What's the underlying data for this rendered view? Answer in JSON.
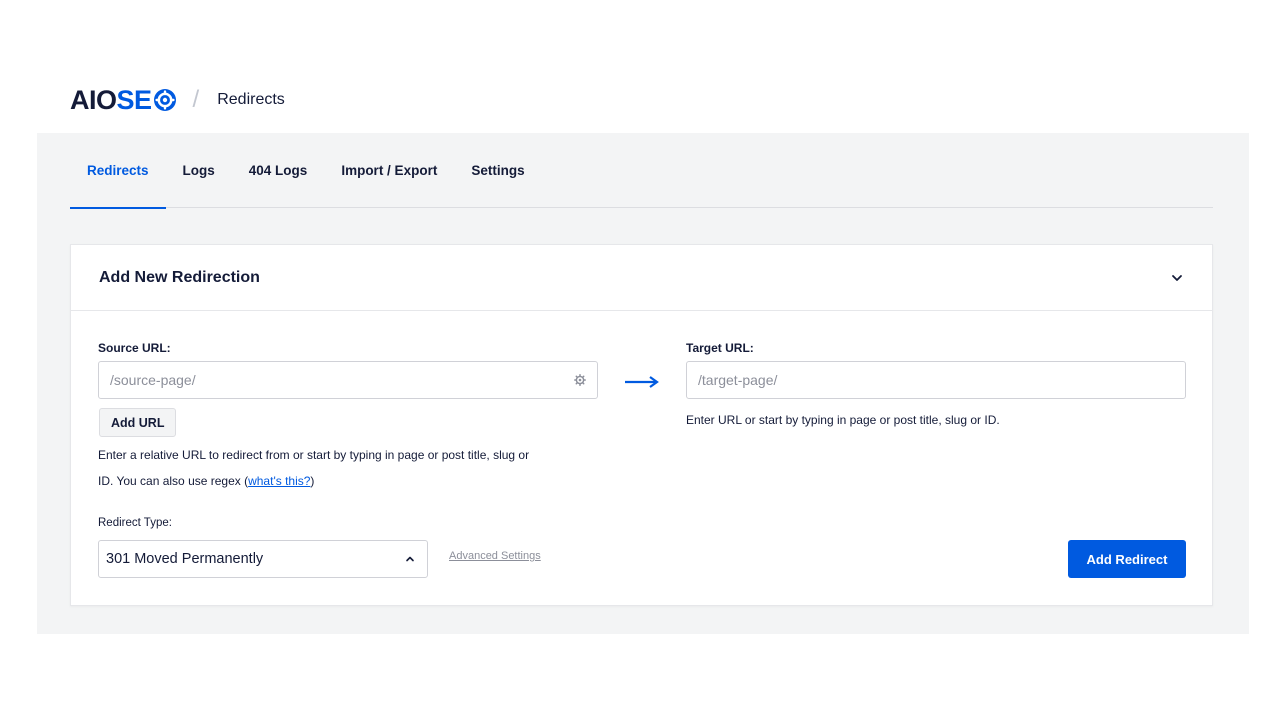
{
  "header": {
    "logo_part1": "AIOSE",
    "breadcrumb_separator": "/",
    "breadcrumb": "Redirects"
  },
  "tabs": [
    {
      "label": "Redirects",
      "active": true
    },
    {
      "label": "Logs",
      "active": false
    },
    {
      "label": "404 Logs",
      "active": false
    },
    {
      "label": "Import / Export",
      "active": false
    },
    {
      "label": "Settings",
      "active": false
    }
  ],
  "card": {
    "title": "Add New Redirection",
    "source": {
      "label": "Source URL:",
      "placeholder": "/source-page/",
      "add_url_label": "Add URL",
      "help_text": "Enter a relative URL to redirect from or start by typing in page or post title, slug or",
      "help_text_line2": "ID. You can also use regex (",
      "help_link": "what's this?",
      "help_text_end": ")"
    },
    "target": {
      "label": "Target URL:",
      "placeholder": "/target-page/",
      "help_text": "Enter URL or start by typing in page or post title, slug or ID."
    },
    "redirect_type": {
      "label": "Redirect Type:",
      "selected": "301 Moved Permanently"
    },
    "advanced_settings_label": "Advanced Settings",
    "add_redirect_label": "Add Redirect"
  },
  "colors": {
    "brand_blue": "#005ae0",
    "dark_text": "#141b38",
    "panel_bg": "#f3f4f5"
  },
  "icons": {
    "logo_gear": "gear-icon",
    "collapse": "chevron-down-icon",
    "source_settings": "gear-icon",
    "arrow": "arrow-right-icon",
    "select_caret": "chevron-up-icon"
  }
}
